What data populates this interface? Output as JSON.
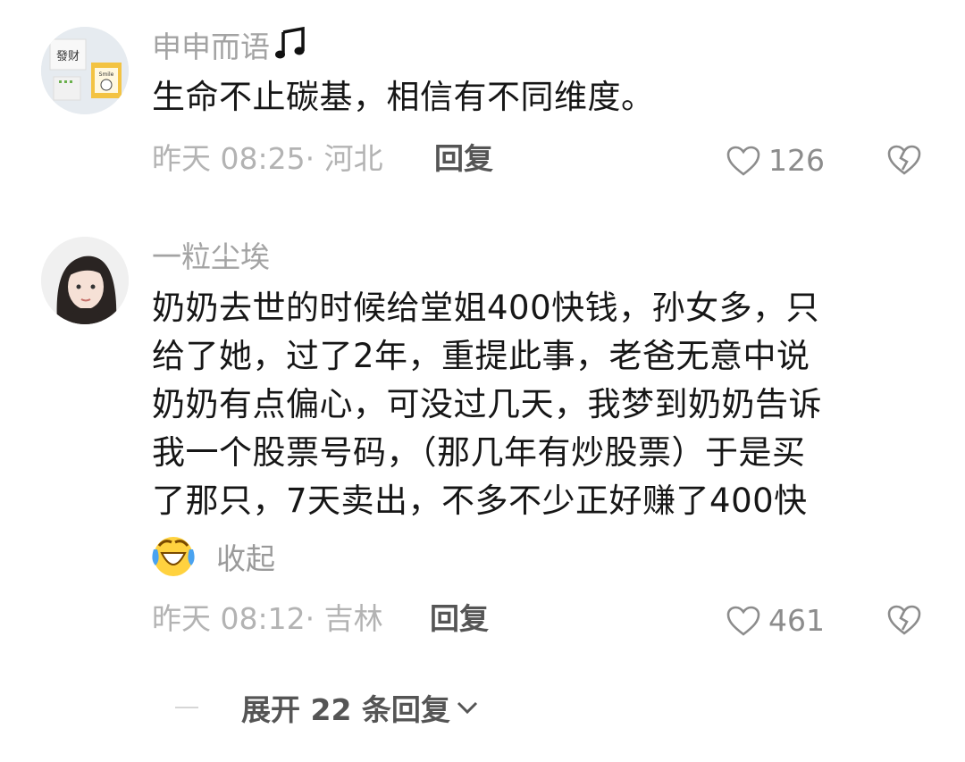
{
  "comments": [
    {
      "username": "申申而语",
      "username_icon": "music-note-icon",
      "content": "生命不止碳基，相信有不同维度。",
      "time_location": "昨天 08:25· 河北",
      "reply_label": "回复",
      "likes": "126"
    },
    {
      "username": "一粒尘埃",
      "content": "奶奶去世的时候给堂姐400快钱，孙女多，只\n给了她，过了2年，重提此事，老爸无意中说\n奶奶有点偏心，可没过几天，我梦到奶奶告诉\n我一个股票号码，（那几年有炒股票）于是买\n了那只，7天卖出，不多不少正好赚了400快",
      "emoji": "laughing-crying-emoji",
      "collapse_label": "收起",
      "time_location": "昨天 08:12· 吉林",
      "reply_label": "回复",
      "likes": "461"
    }
  ],
  "expand_replies": {
    "label": "展开 22 条回复",
    "icon": "chevron-down-icon"
  },
  "avatar1_text": [
    "發财",
    "Smile"
  ],
  "colors": {
    "username": "#a3a3a3",
    "meta": "#b3b3b3",
    "reply": "#555555",
    "content": "#161616"
  }
}
